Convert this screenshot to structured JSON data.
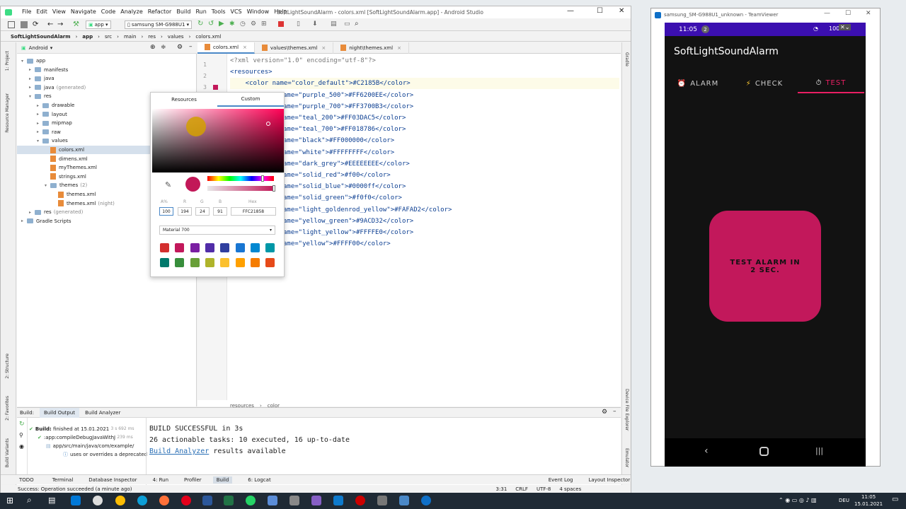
{
  "window": {
    "title": "SoftLightSoundAlarm - colors.xml [SoftLightSoundAlarm.app] - Android Studio",
    "menu": [
      "File",
      "Edit",
      "View",
      "Navigate",
      "Code",
      "Analyze",
      "Refactor",
      "Build",
      "Run",
      "Tools",
      "VCS",
      "Window",
      "Help"
    ]
  },
  "toolbar": {
    "config": "app",
    "device": "samsung SM-G988U1"
  },
  "breadcrumb": [
    "SoftLightSoundAlarm",
    "app",
    "src",
    "main",
    "res",
    "values",
    "colors.xml"
  ],
  "project": {
    "view": "Android",
    "tree": [
      {
        "label": "app",
        "depth": 0
      },
      {
        "label": "manifests",
        "depth": 1
      },
      {
        "label": "java",
        "depth": 1
      },
      {
        "label": "java",
        "suffix": "(generated)",
        "depth": 1
      },
      {
        "label": "res",
        "depth": 1
      },
      {
        "label": "drawable",
        "depth": 2
      },
      {
        "label": "layout",
        "depth": 2
      },
      {
        "label": "mipmap",
        "depth": 2
      },
      {
        "label": "raw",
        "depth": 2
      },
      {
        "label": "values",
        "depth": 2
      },
      {
        "label": "colors.xml",
        "depth": 3
      },
      {
        "label": "dimens.xml",
        "depth": 3
      },
      {
        "label": "myThemes.xml",
        "depth": 3
      },
      {
        "label": "strings.xml",
        "depth": 3
      },
      {
        "label": "themes",
        "suffix": "(2)",
        "depth": 3
      },
      {
        "label": "themes.xml",
        "depth": 4
      },
      {
        "label": "themes.xml",
        "suffix": "(night)",
        "depth": 4
      },
      {
        "label": "res",
        "suffix": "(generated)",
        "depth": 1
      },
      {
        "label": "Gradle Scripts",
        "depth": 0
      }
    ]
  },
  "editor": {
    "tabs": [
      "colors.xml",
      "values\\themes.xml",
      "night\\themes.xml"
    ],
    "lines": [
      "<?xml version=\"1.0\" encoding=\"utf-8\"?>",
      "<resources>",
      "    <color name=\"color_default\">#C2185B</color>",
      "ame=\"purple_500\">#FF6200EE</color>",
      "ame=\"purple_700\">#FF3700B3</color>",
      "ame=\"teal_200\">#FF03DAC5</color>",
      "ame=\"teal_700\">#FF018786</color>",
      "ame=\"black\">#FF000000</color>",
      "ame=\"white\">#FFFFFFFF</color>",
      "ame=\"dark_grey\">#EEEEEEEE</color>",
      "ame=\"solid_red\">#f00</color>",
      "ame=\"solid_blue\">#0000ff</color>",
      "ame=\"solid_green\">#f0f0</color>",
      "ame=\"light_goldenrod_yellow\">#FAFAD2</color>",
      "ame=\"yellow_green\">#9ACD32</color>",
      "ame=\"light_yellow\">#FFFFE0</color>",
      "ame=\"yellow\">#FFFF00</color>"
    ],
    "line_numbers": [
      "1",
      "2",
      "3"
    ],
    "crumb": [
      "resources",
      "color"
    ]
  },
  "picker": {
    "tabs": [
      "Resources",
      "Custom"
    ],
    "labels": [
      "A%",
      "R",
      "G",
      "B",
      "Hex"
    ],
    "values": [
      "100",
      "194",
      "24",
      "91",
      "FFC21858"
    ],
    "palette": "Material 700",
    "color": "#C21858",
    "swatches": [
      "#d32f2f",
      "#c2185b",
      "#7b1fa2",
      "#512da8",
      "#303f9f",
      "#1976d2",
      "#0288d1",
      "#0097a7",
      "#00796b",
      "#388e3c",
      "#689f38",
      "#afb42b",
      "#fbc02d",
      "#ffa000",
      "#f57c00",
      "#e64a19"
    ]
  },
  "build": {
    "tabs": [
      "Build:",
      "Build Output",
      "Build Analyzer"
    ],
    "tree": [
      {
        "label": "Build:",
        "detail": "finished at 15.01.2021",
        "time": "3 s 692 ms"
      },
      {
        "label": ":app:compileDebugJavaWithJ",
        "time": "239 ms"
      },
      {
        "label": "app/src/main/java/com/example/"
      },
      {
        "label": "uses or overrides a deprecated"
      }
    ],
    "output": [
      "BUILD SUCCESSFUL in 3s",
      "26 actionable tasks: 10 executed, 16 up-to-date",
      "",
      "Build Analyzer results available"
    ],
    "analyzer_link": "Build Analyzer",
    "analyzer_rest": " results available"
  },
  "bottom_tabs": [
    "TODO",
    "Terminal",
    "Database Inspector",
    "4: Run",
    "Profiler",
    "Build",
    "6: Logcat",
    "Event Log",
    "Layout Inspector"
  ],
  "status": {
    "message": "Success: Operation succeeded (a minute ago)",
    "position": "3:31",
    "eol": "CRLF",
    "encoding": "UTF-8",
    "indent": "4 spaces"
  },
  "left_strip": [
    "1: Project",
    "Resource Manager",
    "2: Structure",
    "2: Favorites",
    "Build Variants"
  ],
  "right_strip": [
    "Gradle",
    "Device File Explorer",
    "Emulator"
  ],
  "teamviewer": {
    "title": "samsung_SM-G988U1_unknown - TeamViewer",
    "time": "11:05",
    "notif": "2",
    "battery": "100%",
    "app_title": "SoftLightSoundAlarm",
    "tabs": [
      "ALARM",
      "CHECK",
      "TEST"
    ],
    "button": "TEST ALARM IN 2 SEC."
  },
  "taskbar": {
    "lang": "DEU",
    "time": "11:05",
    "date": "15.01.2021"
  }
}
